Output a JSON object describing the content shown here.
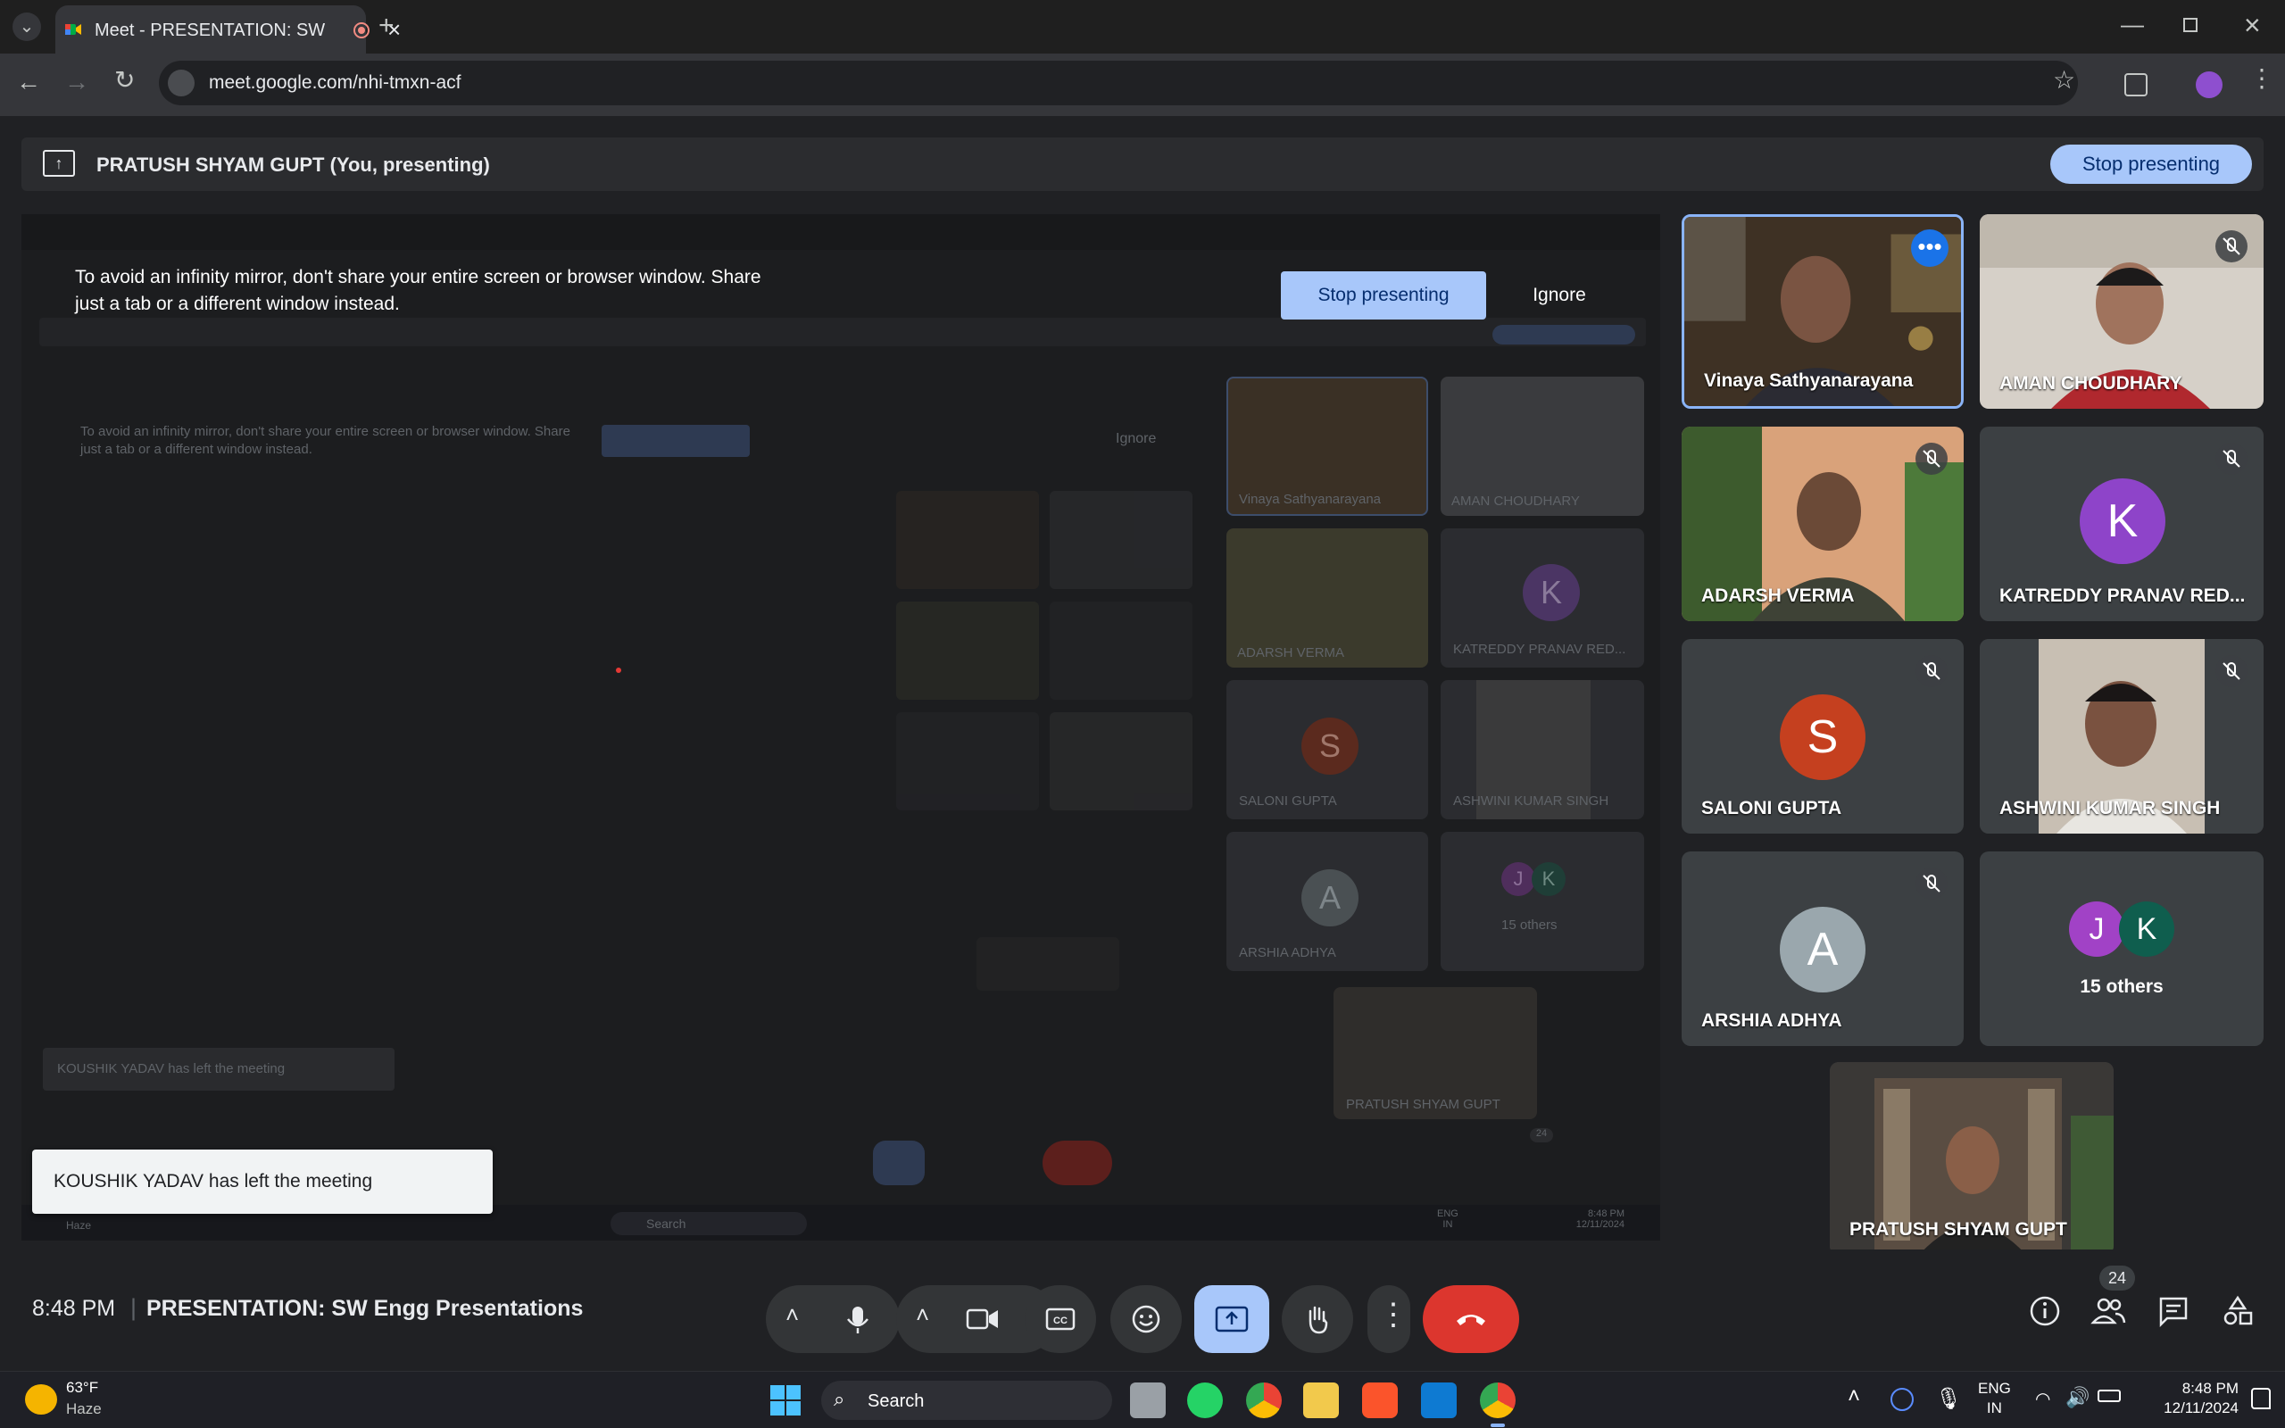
{
  "browser": {
    "tab_title": "Meet - PRESENTATION: SW",
    "url": "meet.google.com/nhi-tmxn-acf"
  },
  "presenting_bar": {
    "text": "PRATUSH SHYAM GUPT (You, presenting)",
    "stop_label": "Stop presenting"
  },
  "warning": {
    "text_line1": "To avoid an infinity mirror, don't share your entire screen or browser window. Share",
    "text_line2": "just a tab or a different window instead.",
    "stop_label": "Stop presenting",
    "ignore_label": "Ignore"
  },
  "participants": [
    {
      "name": "Vinaya Sathyanarayana",
      "type": "video",
      "muted": false,
      "speaking": true
    },
    {
      "name": "AMAN CHOUDHARY",
      "type": "video",
      "muted": true
    },
    {
      "name": "ADARSH VERMA",
      "type": "video",
      "muted": true
    },
    {
      "name": "KATREDDY PRANAV RED...",
      "type": "avatar",
      "initial": "K",
      "color": "#8e44c9",
      "muted": true
    },
    {
      "name": "SALONI GUPTA",
      "type": "avatar",
      "initial": "S",
      "color": "#c5401f",
      "muted": true
    },
    {
      "name": "ASHWINI KUMAR SINGH",
      "type": "video",
      "muted": true
    },
    {
      "name": "ARSHIA ADHYA",
      "type": "avatar",
      "initial": "A",
      "color": "#9aa7ad",
      "muted": true
    },
    {
      "name": "15 others",
      "type": "others",
      "initials": [
        "J",
        "K"
      ],
      "colors": [
        "#a142c6",
        "#0f5e4e"
      ]
    }
  ],
  "self_tile": {
    "name": "PRATUSH SHYAM GUPT"
  },
  "toast": {
    "text": "KOUSHIK YADAV has left the meeting"
  },
  "mirror_toast": {
    "text": "KOUSHIK YADAV has left the meeting"
  },
  "meeting": {
    "time": "8:48 PM",
    "separator": "|",
    "title": "PRESENTATION: SW Engg Presentations",
    "participant_count": "24"
  },
  "mirror": {
    "search_label": "Search",
    "others_label": "15 others",
    "names": [
      "Vinaya Sathyanarayana",
      "AMAN CHOUDHARY",
      "ADARSH VERMA",
      "KATREDDY PRANAV RED...",
      "SALONI GUPTA",
      "ASHWINI KUMAR SINGH",
      "ARSHIA ADHYA",
      "PRATUSH SHYAM GUPT"
    ],
    "count": "24",
    "lang": "ENG",
    "region": "IN",
    "time": "8:48 PM",
    "date": "12/11/2024",
    "weather_label": "Haze"
  },
  "taskbar": {
    "temp": "63°F",
    "weather": "Haze",
    "search_label": "Search",
    "lang": "ENG",
    "region": "IN",
    "time": "8:48 PM",
    "date": "12/11/2024"
  },
  "colors": {
    "accent": "#a8c7fa",
    "end_call": "#dc362e",
    "highlight": "#8ab4f8"
  }
}
